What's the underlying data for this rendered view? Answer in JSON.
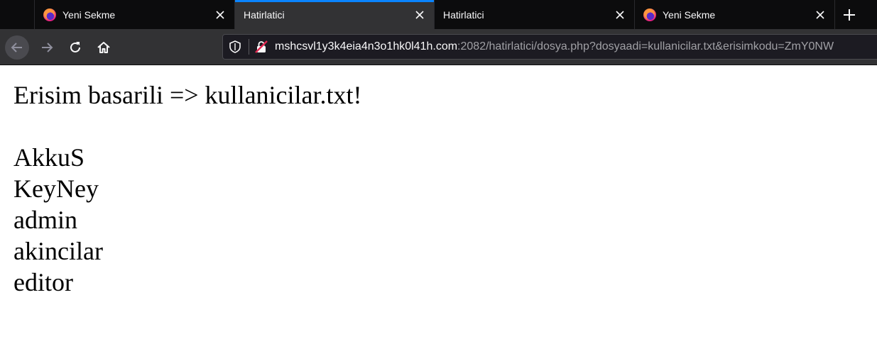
{
  "browser": {
    "tabs": [
      {
        "title": "Yeni Sekme",
        "has_favicon": true,
        "active": false
      },
      {
        "title": "Hatirlatici",
        "has_favicon": false,
        "active": true
      },
      {
        "title": "Hatirlatici",
        "has_favicon": false,
        "active": false
      },
      {
        "title": "Yeni Sekme",
        "has_favicon": true,
        "active": false
      }
    ],
    "new_tab_icon": "plus-icon",
    "nav_icons": [
      "back-arrow-icon",
      "forward-arrow-icon",
      "reload-icon",
      "home-icon"
    ],
    "url": {
      "host": "mshcsvl1y3k4eia4n3o1hk0l41h.com",
      "rest": ":2082/hatirlatici/dosya.php?dosyaadi=kullanicilar.txt&erisimkodu=ZmY0NW"
    },
    "accent_color": "#0a84ff"
  },
  "page": {
    "heading": "Erisim basarili => kullanicilar.txt!",
    "users": [
      "AkkuS",
      "KeyNey",
      "admin",
      "akincilar",
      "editor"
    ]
  }
}
